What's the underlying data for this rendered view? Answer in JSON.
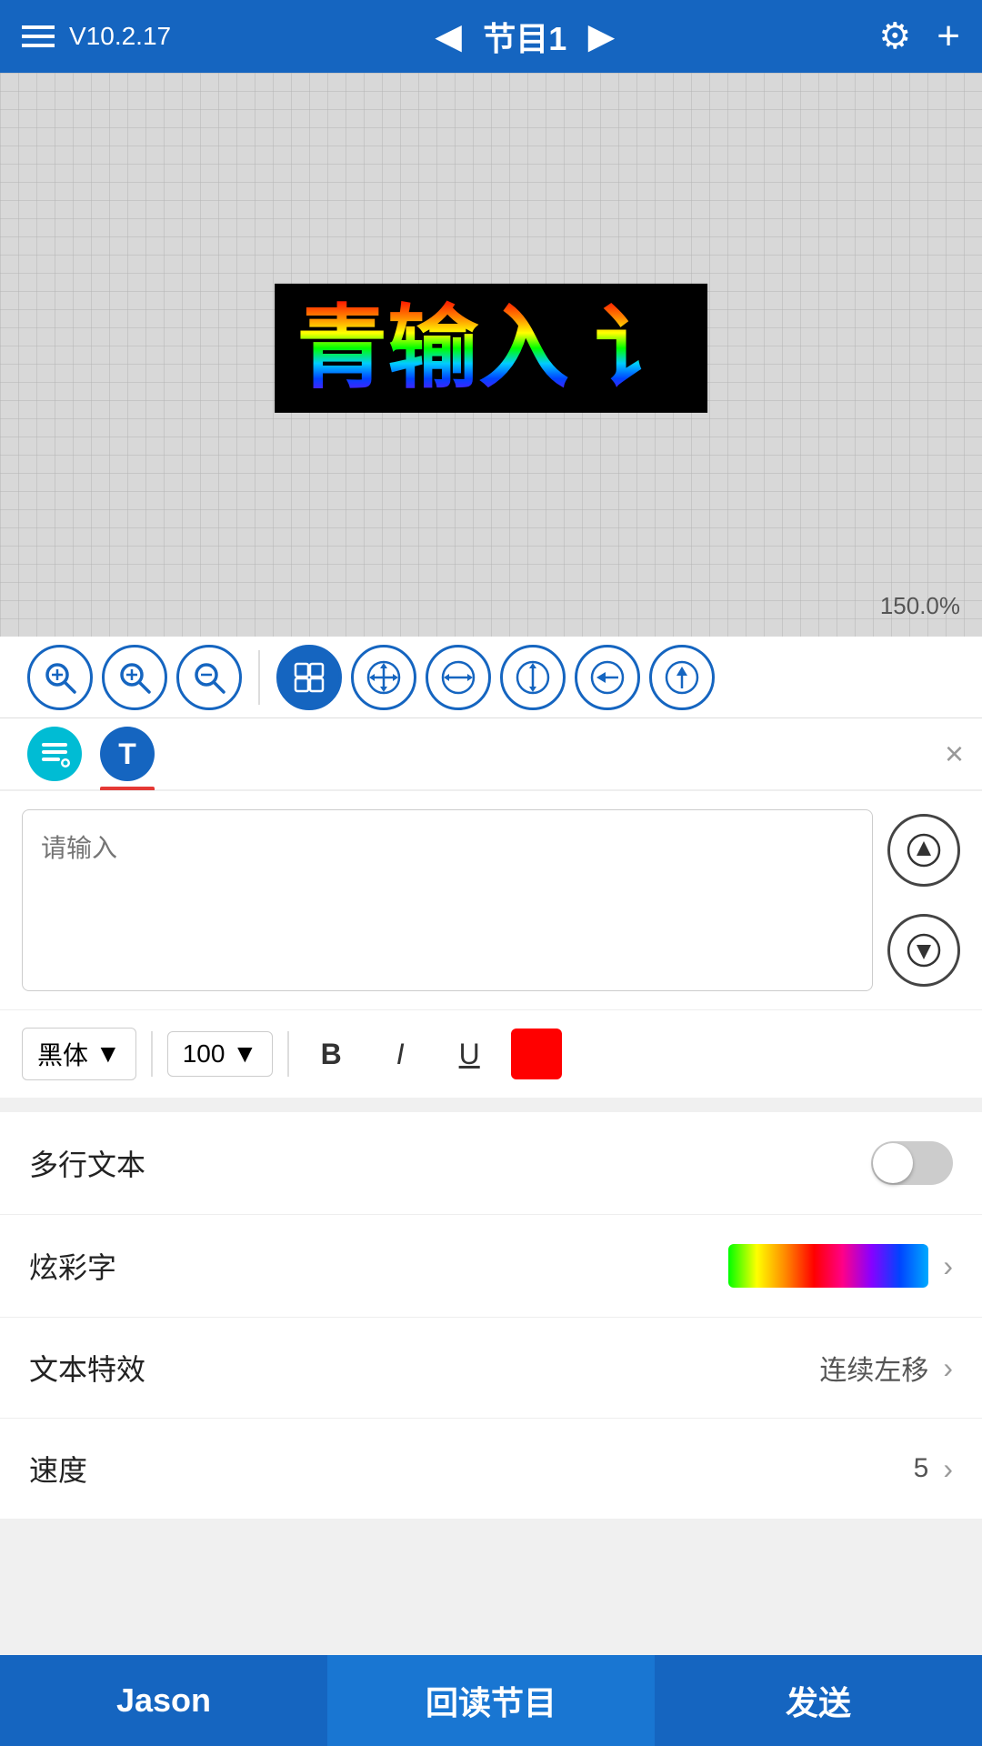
{
  "topbar": {
    "version": "V10.2.17",
    "title": "节目1",
    "settings_icon": "⚙",
    "plus_icon": "+"
  },
  "canvas": {
    "zoom_label": "150.0%",
    "led_text": "青输入 讠"
  },
  "toolbar": {
    "zoom_fit": "⊞",
    "move": "✛",
    "stretch_h": "↔",
    "stretch_v": "↕",
    "arrow_left": "←",
    "arrow_up": "↑",
    "zoom_in": "+",
    "zoom_out": "−",
    "zoom_reset": "○"
  },
  "tabs": {
    "tab1_icon": "≡",
    "tab2_icon": "T",
    "close_icon": "×"
  },
  "text_input": {
    "placeholder": "请输入",
    "arrow_up": "↑",
    "arrow_down": "↓"
  },
  "format_bar": {
    "font_name": "黑体",
    "font_size": "100",
    "bold_label": "B",
    "italic_label": "I",
    "underline_label": "U",
    "color": "#ff0000"
  },
  "settings": {
    "multiline_label": "多行文本",
    "multiline_on": false,
    "rainbow_label": "炫彩字",
    "effect_label": "文本特效",
    "effect_value": "连续左移",
    "speed_label": "速度",
    "speed_value": "5"
  },
  "bottom": {
    "btn1_label": "Jason",
    "btn2_label": "回读节目",
    "btn3_label": "发送"
  }
}
